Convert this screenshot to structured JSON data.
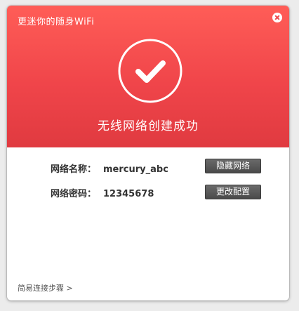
{
  "window": {
    "title": "更迷你的随身WiFi"
  },
  "status": {
    "message": "无线网络创建成功",
    "icon": "check-circle-icon"
  },
  "network": {
    "name_label": "网络名称：",
    "name_value": "mercury_abc",
    "password_label": "网络密码：",
    "password_value": "12345678"
  },
  "buttons": {
    "hide_network": "隐藏网络",
    "change_config": "更改配置"
  },
  "footer": {
    "steps_link": "简易连接步骤 >"
  },
  "colors": {
    "header_red": "#f0454a",
    "button_dark": "#4a4a4a"
  }
}
